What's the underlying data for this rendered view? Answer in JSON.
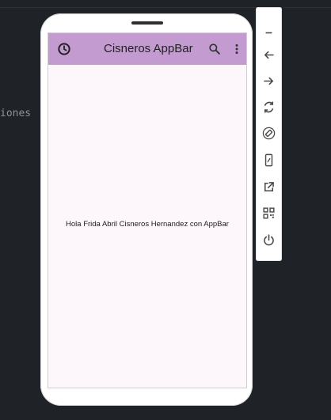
{
  "editor": {
    "fragment": "iones"
  },
  "app": {
    "title": "Cisneros AppBar",
    "body": "Hola Frida Abril Cisneros Hernandez con AppBar",
    "colors": {
      "appbar": "#c49bd0",
      "background": "#fdf7fb"
    },
    "icons": [
      "history-icon",
      "search-icon",
      "more-vert-icon"
    ]
  },
  "toolbar": {
    "icons": [
      "minimize-icon",
      "back-icon",
      "forward-icon",
      "rotate-icon",
      "rotate-screen-icon",
      "fold-icon",
      "open-external-icon",
      "qr-code-icon",
      "power-icon"
    ]
  }
}
